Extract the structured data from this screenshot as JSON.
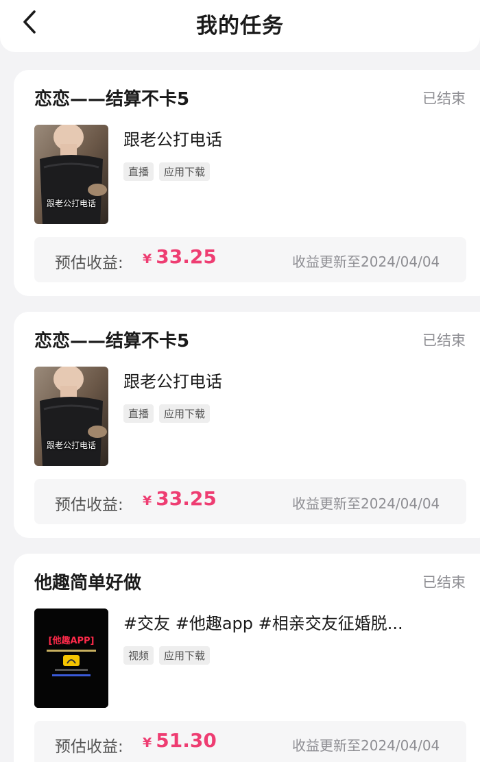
{
  "header": {
    "title": "我的任务",
    "back_icon": "chevron-left-icon"
  },
  "colors": {
    "accent": "#ee3d72",
    "background": "#f3f3f5",
    "card": "#ffffff",
    "muted": "#8e8e93"
  },
  "earnings_label": "预估收益:",
  "currency_symbol": "¥",
  "tasks": [
    {
      "title": "恋恋——结算不卡5",
      "status": "已结束",
      "video_name": "跟老公打电话",
      "thumbnail_caption": "跟老公打电话",
      "tags": [
        "直播",
        "应用下载"
      ],
      "earnings": "33.25",
      "update_note": "收益更新至2024/04/04"
    },
    {
      "title": "恋恋——结算不卡5",
      "status": "已结束",
      "video_name": "跟老公打电话",
      "thumbnail_caption": "跟老公打电话",
      "tags": [
        "直播",
        "应用下载"
      ],
      "earnings": "33.25",
      "update_note": "收益更新至2024/04/04"
    },
    {
      "title": "他趣简单好做",
      "status": "已结束",
      "video_name": "#交友 #他趣app #相亲交友征婚脱...",
      "thumbnail_caption": "[他趣APP]",
      "tags": [
        "视频",
        "应用下载"
      ],
      "earnings": "51.30",
      "update_note": "收益更新至2024/04/04"
    }
  ]
}
